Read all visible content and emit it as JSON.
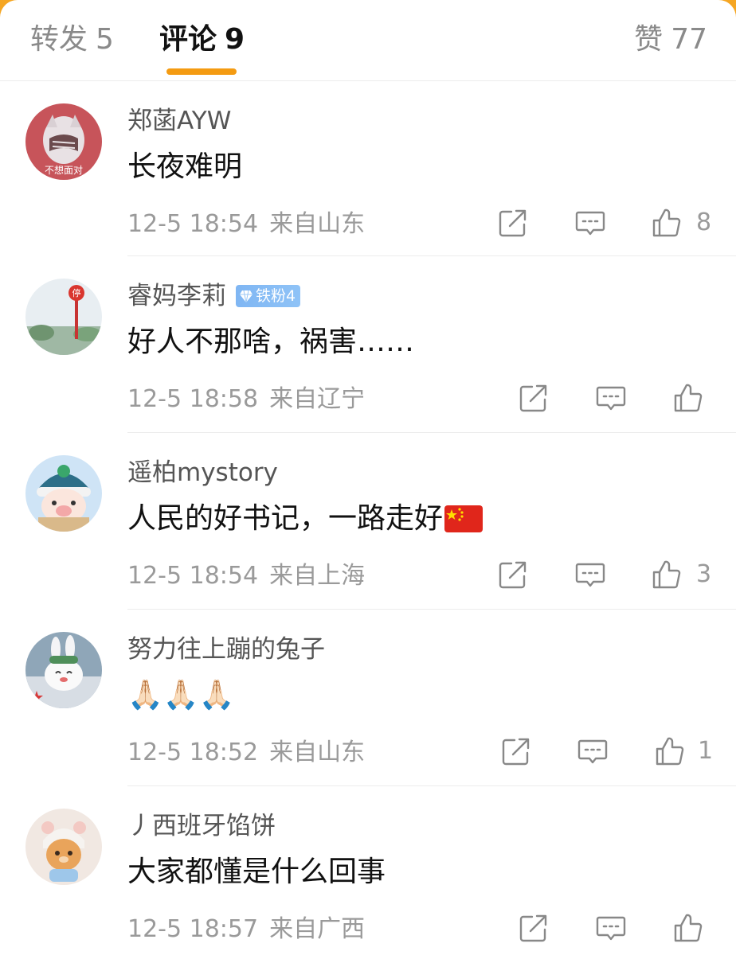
{
  "tabs": {
    "repost": {
      "label": "转发",
      "count": "5"
    },
    "comments": {
      "label": "评论",
      "count": "9"
    },
    "likes": {
      "label": "赞",
      "count": "77"
    }
  },
  "comments": [
    {
      "username": "郑菡AYW",
      "text": "长夜难明",
      "time": "12-5 18:54",
      "location": "来自山东",
      "likes": "8",
      "avatar_caption": "不想面对"
    },
    {
      "username": "睿妈李莉",
      "badge": "铁粉4",
      "text": "好人不那啥，祸害……",
      "time": "12-5 18:58",
      "location": "来自辽宁",
      "likes": "",
      "avatar_caption": "停"
    },
    {
      "username": "遥柏mystory",
      "text": "人民的好书记，一路走好",
      "time": "12-5 18:54",
      "location": "来自上海",
      "likes": "3"
    },
    {
      "username": "努力往上蹦的兔子",
      "text": "🙏🏻🙏🏻🙏🏻",
      "time": "12-5 18:52",
      "location": "来自山东",
      "likes": "1"
    },
    {
      "username": "丿西班牙馅饼",
      "text": "大家都懂是什么回事",
      "time": "12-5 18:57",
      "location": "来自广西",
      "likes": ""
    }
  ],
  "icons": {
    "repost": "share-square-icon",
    "comment": "comment-bubble-icon",
    "like": "thumbs-up-icon",
    "flag": "china-flag-icon"
  },
  "colors": {
    "accent": "#f49b12",
    "badge": "#8fc3f7"
  }
}
